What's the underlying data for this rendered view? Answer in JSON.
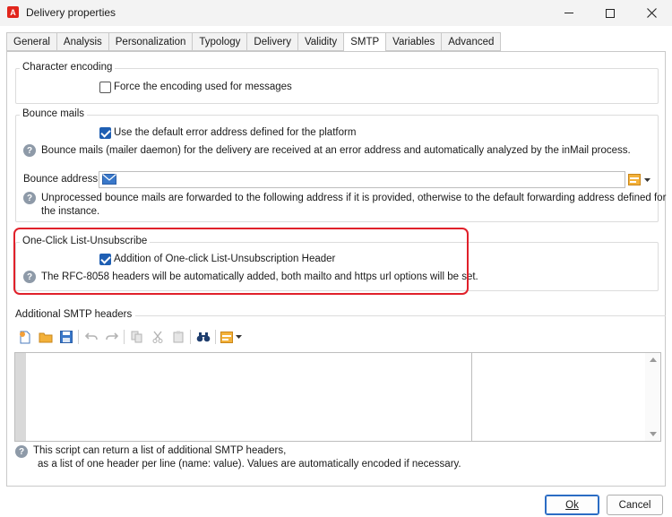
{
  "window": {
    "title": "Delivery properties",
    "logo_letter": "A"
  },
  "tabs": [
    {
      "label": "General",
      "active": false
    },
    {
      "label": "Analysis",
      "active": false
    },
    {
      "label": "Personalization",
      "active": false
    },
    {
      "label": "Typology",
      "active": false
    },
    {
      "label": "Delivery",
      "active": false
    },
    {
      "label": "Validity",
      "active": false
    },
    {
      "label": "SMTP",
      "active": true
    },
    {
      "label": "Variables",
      "active": false
    },
    {
      "label": "Advanced",
      "active": false
    }
  ],
  "character_encoding": {
    "legend": "Character encoding",
    "force_encoding_label": "Force the encoding used for messages",
    "force_encoding_checked": false
  },
  "bounce_mails": {
    "legend": "Bounce mails",
    "default_error_label": "Use the default error address defined for the platform",
    "default_error_checked": true,
    "help_text": "Bounce mails (mailer daemon) for the delivery are received at an error address and automatically analyzed by the inMail process.",
    "address_label": "Bounce address:",
    "address_value": "",
    "unprocessed_help_line1": "Unprocessed bounce mails are forwarded to the following address if it is provided, otherwise to the default forwarding address defined for",
    "unprocessed_help_line2": "the instance."
  },
  "one_click": {
    "legend": "One-Click List-Unsubscribe",
    "header_label": "Addition of One-click List-Unsubscription Header",
    "header_checked": true,
    "help_text": "The RFC-8058 headers will be automatically added, both mailto and https url options will be set."
  },
  "smtp_headers": {
    "legend": "Additional SMTP headers",
    "content": "",
    "help_line1": "This script can return a list of additional SMTP headers,",
    "help_line2": "as a list of one header per line (name: value). Values are automatically encoded if necessary."
  },
  "buttons": {
    "ok": "Ok",
    "cancel": "Cancel"
  },
  "colors": {
    "accent": "#1f5fb3",
    "highlight_border": "#e0202a",
    "logo": "#e1251b"
  }
}
